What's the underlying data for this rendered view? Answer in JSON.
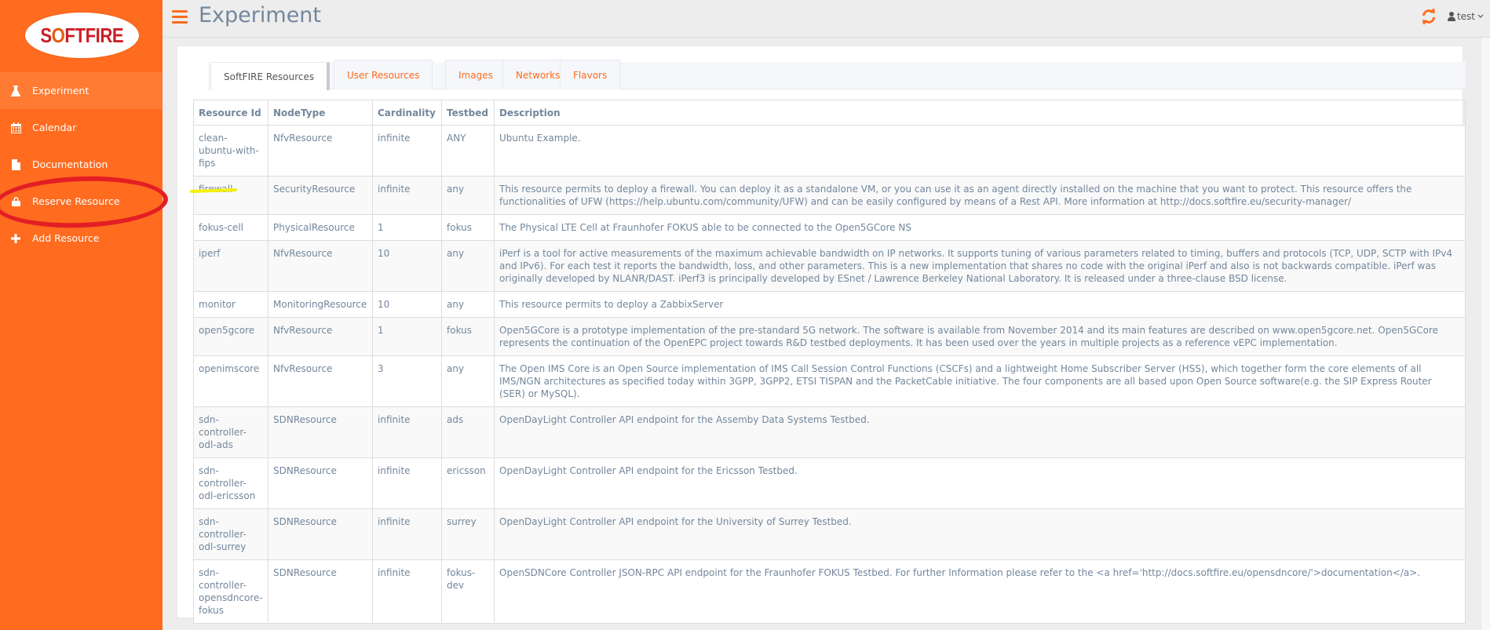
{
  "brand": {
    "logo_text_a": "S",
    "logo_text_o": "O",
    "logo_text_b": "FTFIRE"
  },
  "colors": {
    "accent": "#ff6b1f",
    "sidebar_active": "#ff7a33",
    "annotation_red": "#e31e24",
    "highlight_yellow": "#f5f00c"
  },
  "sidebar": {
    "items": [
      {
        "label": "Experiment",
        "icon": "flask-icon",
        "active": true
      },
      {
        "label": "Calendar",
        "icon": "calendar-icon",
        "active": false
      },
      {
        "label": "Documentation",
        "icon": "file-icon",
        "active": false
      },
      {
        "label": "Reserve Resource",
        "icon": "lock-icon",
        "active": false
      },
      {
        "label": "Add Resource",
        "icon": "plus-icon",
        "active": false
      }
    ]
  },
  "header": {
    "title": "Experiment",
    "menu_icon": "hamburger-icon",
    "refresh_icon": "refresh-icon",
    "user": {
      "name": "test",
      "icon": "user-icon",
      "caret": "chevron-down-icon"
    }
  },
  "tabs": [
    {
      "label": "SoftFIRE Resources",
      "active": true
    },
    {
      "label": "User Resources",
      "active": false
    },
    {
      "label": "Images",
      "active": false
    },
    {
      "label": "Networks",
      "active": false
    },
    {
      "label": "Flavors",
      "active": false
    }
  ],
  "table": {
    "columns": [
      "Resource Id",
      "NodeType",
      "Cardinality",
      "Testbed",
      "Description"
    ],
    "rows": [
      [
        "clean-ubuntu-with-fips",
        "NfvResource",
        "infinite",
        "ANY",
        "Ubuntu Example."
      ],
      [
        "firewall",
        "SecurityResource",
        "infinite",
        "any",
        "This resource permits to deploy a firewall. You can deploy it as a standalone VM, or you can use it as an agent directly installed on the machine that you want to protect. This resource offers the functionalities of UFW (https://help.ubuntu.com/community/UFW) and can be easily configured by means of a Rest API. More information at http://docs.softfire.eu/security-manager/"
      ],
      [
        "fokus-cell",
        "PhysicalResource",
        "1",
        "fokus",
        "The Physical LTE Cell at Fraunhofer FOKUS able to be connected to the Open5GCore NS"
      ],
      [
        "iperf",
        "NfvResource",
        "10",
        "any",
        "iPerf is a tool for active measurements of the maximum achievable bandwidth on IP networks. It supports tuning of various parameters related to timing, buffers and protocols (TCP, UDP, SCTP with IPv4 and IPv6). For each test it reports the bandwidth, loss, and other parameters. This is a new implementation that shares no code with the original iPerf and also is not backwards compatible. iPerf was originally developed by NLANR/DAST. iPerf3 is principally developed by ESnet / Lawrence Berkeley National Laboratory. It is released under a three-clause BSD license."
      ],
      [
        "monitor",
        "MonitoringResource",
        "10",
        "any",
        "This resource permits to deploy a ZabbixServer"
      ],
      [
        "open5gcore",
        "NfvResource",
        "1",
        "fokus",
        "Open5GCore is a prototype implementation of the pre-standard 5G network. The software is available from November 2014 and its main features are described on www.open5gcore.net. Open5GCore represents the continuation of the OpenEPC project towards R&D testbed deployments. It has been used over the years in multiple projects as a reference vEPC implementation."
      ],
      [
        "openimscore",
        "NfvResource",
        "3",
        "any",
        "The Open IMS Core is an Open Source implementation of IMS Call Session Control Functions (CSCFs) and a lightweight Home Subscriber Server (HSS), which together form the core elements of all IMS/NGN architectures as specified today within 3GPP, 3GPP2, ETSI TISPAN and the PacketCable initiative. The four components are all based upon Open Source software(e.g. the SIP Express Router (SER) or MySQL)."
      ],
      [
        "sdn-controller-odl-ads",
        "SDNResource",
        "infinite",
        "ads",
        "OpenDayLight Controller API endpoint for the Assemby Data Systems Testbed."
      ],
      [
        "sdn-controller-odl-ericsson",
        "SDNResource",
        "infinite",
        "ericsson",
        "OpenDayLight Controller API endpoint for the Ericsson Testbed."
      ],
      [
        "sdn-controller-odl-surrey",
        "SDNResource",
        "infinite",
        "surrey",
        "OpenDayLight Controller API endpoint for the University of Surrey Testbed."
      ],
      [
        "sdn-controller-opensdncore-fokus",
        "SDNResource",
        "infinite",
        "fokus-dev",
        "OpenSDNCore Controller JSON-RPC API endpoint for the Fraunhofer FOKUS Testbed. For further Information please refer to the <a href='http://docs.softfire.eu/opensdncore/'>documentation</a>."
      ]
    ]
  }
}
